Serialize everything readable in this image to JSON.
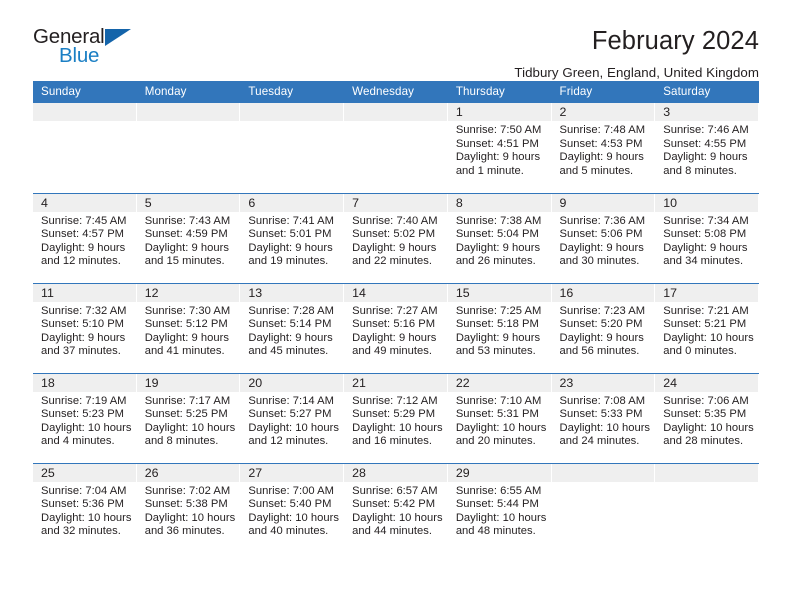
{
  "brand": {
    "name_part1": "General",
    "name_part2": "Blue",
    "logo_icon": "triangle-icon",
    "accent_color": "#1464aa"
  },
  "header": {
    "title": "February 2024",
    "subtitle": "Tidbury Green, England, United Kingdom"
  },
  "calendar": {
    "header_color": "#3276bb",
    "daynum_bg": "#efefef",
    "weekdays": [
      "Sunday",
      "Monday",
      "Tuesday",
      "Wednesday",
      "Thursday",
      "Friday",
      "Saturday"
    ],
    "weeks": [
      [
        {
          "day": "",
          "lines": []
        },
        {
          "day": "",
          "lines": []
        },
        {
          "day": "",
          "lines": []
        },
        {
          "day": "",
          "lines": []
        },
        {
          "day": "1",
          "lines": [
            "Sunrise: 7:50 AM",
            "Sunset: 4:51 PM",
            "Daylight: 9 hours",
            "and 1 minute."
          ]
        },
        {
          "day": "2",
          "lines": [
            "Sunrise: 7:48 AM",
            "Sunset: 4:53 PM",
            "Daylight: 9 hours",
            "and 5 minutes."
          ]
        },
        {
          "day": "3",
          "lines": [
            "Sunrise: 7:46 AM",
            "Sunset: 4:55 PM",
            "Daylight: 9 hours",
            "and 8 minutes."
          ]
        }
      ],
      [
        {
          "day": "4",
          "lines": [
            "Sunrise: 7:45 AM",
            "Sunset: 4:57 PM",
            "Daylight: 9 hours",
            "and 12 minutes."
          ]
        },
        {
          "day": "5",
          "lines": [
            "Sunrise: 7:43 AM",
            "Sunset: 4:59 PM",
            "Daylight: 9 hours",
            "and 15 minutes."
          ]
        },
        {
          "day": "6",
          "lines": [
            "Sunrise: 7:41 AM",
            "Sunset: 5:01 PM",
            "Daylight: 9 hours",
            "and 19 minutes."
          ]
        },
        {
          "day": "7",
          "lines": [
            "Sunrise: 7:40 AM",
            "Sunset: 5:02 PM",
            "Daylight: 9 hours",
            "and 22 minutes."
          ]
        },
        {
          "day": "8",
          "lines": [
            "Sunrise: 7:38 AM",
            "Sunset: 5:04 PM",
            "Daylight: 9 hours",
            "and 26 minutes."
          ]
        },
        {
          "day": "9",
          "lines": [
            "Sunrise: 7:36 AM",
            "Sunset: 5:06 PM",
            "Daylight: 9 hours",
            "and 30 minutes."
          ]
        },
        {
          "day": "10",
          "lines": [
            "Sunrise: 7:34 AM",
            "Sunset: 5:08 PM",
            "Daylight: 9 hours",
            "and 34 minutes."
          ]
        }
      ],
      [
        {
          "day": "11",
          "lines": [
            "Sunrise: 7:32 AM",
            "Sunset: 5:10 PM",
            "Daylight: 9 hours",
            "and 37 minutes."
          ]
        },
        {
          "day": "12",
          "lines": [
            "Sunrise: 7:30 AM",
            "Sunset: 5:12 PM",
            "Daylight: 9 hours",
            "and 41 minutes."
          ]
        },
        {
          "day": "13",
          "lines": [
            "Sunrise: 7:28 AM",
            "Sunset: 5:14 PM",
            "Daylight: 9 hours",
            "and 45 minutes."
          ]
        },
        {
          "day": "14",
          "lines": [
            "Sunrise: 7:27 AM",
            "Sunset: 5:16 PM",
            "Daylight: 9 hours",
            "and 49 minutes."
          ]
        },
        {
          "day": "15",
          "lines": [
            "Sunrise: 7:25 AM",
            "Sunset: 5:18 PM",
            "Daylight: 9 hours",
            "and 53 minutes."
          ]
        },
        {
          "day": "16",
          "lines": [
            "Sunrise: 7:23 AM",
            "Sunset: 5:20 PM",
            "Daylight: 9 hours",
            "and 56 minutes."
          ]
        },
        {
          "day": "17",
          "lines": [
            "Sunrise: 7:21 AM",
            "Sunset: 5:21 PM",
            "Daylight: 10 hours",
            "and 0 minutes."
          ]
        }
      ],
      [
        {
          "day": "18",
          "lines": [
            "Sunrise: 7:19 AM",
            "Sunset: 5:23 PM",
            "Daylight: 10 hours",
            "and 4 minutes."
          ]
        },
        {
          "day": "19",
          "lines": [
            "Sunrise: 7:17 AM",
            "Sunset: 5:25 PM",
            "Daylight: 10 hours",
            "and 8 minutes."
          ]
        },
        {
          "day": "20",
          "lines": [
            "Sunrise: 7:14 AM",
            "Sunset: 5:27 PM",
            "Daylight: 10 hours",
            "and 12 minutes."
          ]
        },
        {
          "day": "21",
          "lines": [
            "Sunrise: 7:12 AM",
            "Sunset: 5:29 PM",
            "Daylight: 10 hours",
            "and 16 minutes."
          ]
        },
        {
          "day": "22",
          "lines": [
            "Sunrise: 7:10 AM",
            "Sunset: 5:31 PM",
            "Daylight: 10 hours",
            "and 20 minutes."
          ]
        },
        {
          "day": "23",
          "lines": [
            "Sunrise: 7:08 AM",
            "Sunset: 5:33 PM",
            "Daylight: 10 hours",
            "and 24 minutes."
          ]
        },
        {
          "day": "24",
          "lines": [
            "Sunrise: 7:06 AM",
            "Sunset: 5:35 PM",
            "Daylight: 10 hours",
            "and 28 minutes."
          ]
        }
      ],
      [
        {
          "day": "25",
          "lines": [
            "Sunrise: 7:04 AM",
            "Sunset: 5:36 PM",
            "Daylight: 10 hours",
            "and 32 minutes."
          ]
        },
        {
          "day": "26",
          "lines": [
            "Sunrise: 7:02 AM",
            "Sunset: 5:38 PM",
            "Daylight: 10 hours",
            "and 36 minutes."
          ]
        },
        {
          "day": "27",
          "lines": [
            "Sunrise: 7:00 AM",
            "Sunset: 5:40 PM",
            "Daylight: 10 hours",
            "and 40 minutes."
          ]
        },
        {
          "day": "28",
          "lines": [
            "Sunrise: 6:57 AM",
            "Sunset: 5:42 PM",
            "Daylight: 10 hours",
            "and 44 minutes."
          ]
        },
        {
          "day": "29",
          "lines": [
            "Sunrise: 6:55 AM",
            "Sunset: 5:44 PM",
            "Daylight: 10 hours",
            "and 48 minutes."
          ]
        },
        {
          "day": "",
          "lines": []
        },
        {
          "day": "",
          "lines": []
        }
      ]
    ]
  }
}
